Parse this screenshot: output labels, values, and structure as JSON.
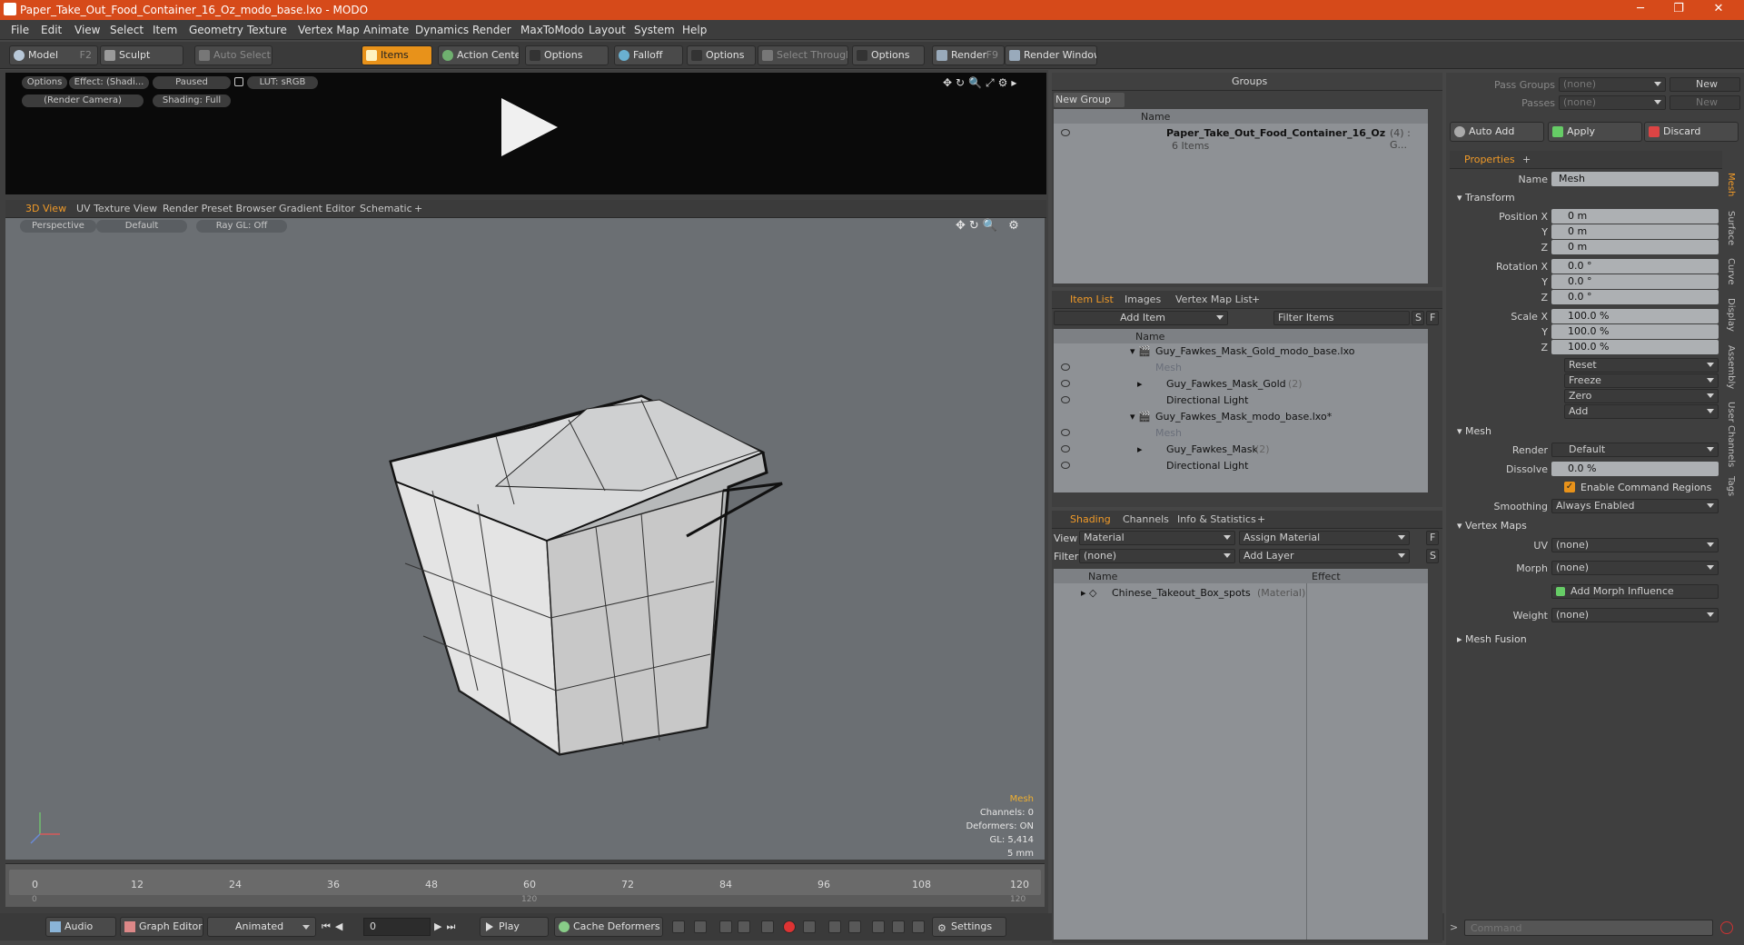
{
  "window": {
    "title": "Paper_Take_Out_Food_Container_16_Oz_modo_base.lxo - MODO"
  },
  "menu": [
    "File",
    "Edit",
    "View",
    "Select",
    "Item",
    "Geometry",
    "Texture",
    "Vertex Map",
    "Animate",
    "Dynamics",
    "Render",
    "MaxToModo",
    "Layout",
    "System",
    "Help"
  ],
  "toolbar": {
    "model": "Model",
    "model_key": "F2",
    "sculpt": "Sculpt",
    "auto_select": "Auto Select",
    "items": "Items",
    "action_center": "Action Center",
    "options1": "Options",
    "falloff": "Falloff",
    "options2": "Options",
    "select_through": "Select Through",
    "options3": "Options",
    "render": "Render",
    "render_key": "F9",
    "render_window": "Render Window"
  },
  "preview": {
    "options": "Options",
    "effect": "Effect: (Shadi...",
    "paused": "Paused",
    "lut": "LUT: sRGB",
    "camera": "(Render Camera)",
    "shading": "Shading: Full"
  },
  "viewport_tabs": [
    "3D View",
    "UV Texture View",
    "Render Preset Browser",
    "Gradient Editor",
    "Schematic",
    "+"
  ],
  "viewport": {
    "perspective": "Perspective",
    "default": "Default",
    "raygl": "Ray GL: Off",
    "info": {
      "mesh": "Mesh",
      "channels": "Channels: 0",
      "deformers": "Deformers: ON",
      "gl": "GL: 5,414",
      "size": "5 mm"
    }
  },
  "timeline": {
    "ticks": [
      "0",
      "12",
      "24",
      "36",
      "48",
      "60",
      "72",
      "84",
      "96",
      "108",
      "120"
    ],
    "sub_left": "0",
    "sub_mid": "120",
    "sub_right": "120"
  },
  "bottom": {
    "audio": "Audio",
    "graph_editor": "Graph Editor",
    "animated": "Animated",
    "frame": "0",
    "play": "Play",
    "cache": "Cache Deformers",
    "settings": "Settings"
  },
  "groups": {
    "title": "Groups",
    "new_group": "New Group",
    "col_name": "Name",
    "item": "Paper_Take_Out_Food_Container_16_Oz",
    "item_count": "(4) : G...",
    "sub": "6 Items"
  },
  "itemlist": {
    "tabs": [
      "Item List",
      "Images",
      "Vertex Map List",
      "+"
    ],
    "add_item": "Add Item",
    "filter": "Filter Items",
    "s": "S",
    "f": "F",
    "col_name": "Name",
    "rows": [
      {
        "label": "Guy_Fawkes_Mask_Gold_modo_base.lxo",
        "extra": ""
      },
      {
        "label": "Mesh",
        "extra": ""
      },
      {
        "label": "Guy_Fawkes_Mask_Gold",
        "extra": "(2)"
      },
      {
        "label": "Directional Light",
        "extra": ""
      },
      {
        "label": "Guy_Fawkes_Mask_modo_base.lxo*",
        "extra": ""
      },
      {
        "label": "Mesh",
        "extra": ""
      },
      {
        "label": "Guy_Fawkes_Mask",
        "extra": "(2)"
      },
      {
        "label": "Directional Light",
        "extra": ""
      }
    ]
  },
  "shading": {
    "tabs": [
      "Shading",
      "Channels",
      "Info & Statistics",
      "+"
    ],
    "view_label": "View",
    "view_val": "Material",
    "assign": "Assign Material",
    "f": "F",
    "filter_label": "Filter",
    "filter_val": "(none)",
    "add_layer": "Add Layer",
    "s": "S",
    "col_name": "Name",
    "col_effect": "Effect",
    "material": "Chinese_Takeout_Box_spots",
    "material_type": "(Material)"
  },
  "passes": {
    "pass_groups": "Pass Groups",
    "pg_val": "(none)",
    "new1": "New",
    "passes": "Passes",
    "p_val": "(none)",
    "new2": "New",
    "auto_add": "Auto Add",
    "apply": "Apply",
    "discard": "Discard"
  },
  "properties": {
    "tab": "Properties",
    "plus": "+",
    "name_label": "Name",
    "name_val": "Mesh",
    "transform": "Transform",
    "pos_label": "Position X",
    "rot_label": "Rotation X",
    "scale_label": "Scale X",
    "y": "Y",
    "z": "Z",
    "pos": [
      "0 m",
      "0 m",
      "0 m"
    ],
    "rot": [
      "0.0 °",
      "0.0 °",
      "0.0 °"
    ],
    "scale": [
      "100.0 %",
      "100.0 %",
      "100.0 %"
    ],
    "reset": "Reset",
    "freeze": "Freeze",
    "zero": "Zero",
    "add": "Add",
    "mesh": "Mesh",
    "render_label": "Render",
    "render_val": "Default",
    "dissolve_label": "Dissolve",
    "dissolve_val": "0.0 %",
    "cmd_regions": "Enable Command Regions",
    "smoothing_label": "Smoothing",
    "smoothing_val": "Always Enabled",
    "vertex_maps": "Vertex Maps",
    "uv_label": "UV",
    "uv_val": "(none)",
    "morph_label": "Morph",
    "morph_val": "(none)",
    "add_morph": "Add Morph Influence",
    "weight_label": "Weight",
    "weight_val": "(none)",
    "mesh_fusion": "Mesh Fusion",
    "side_tabs": [
      "Mesh",
      "Surface",
      "Curve",
      "Display",
      "Assembly",
      "User Channels",
      "Tags"
    ]
  },
  "command": {
    "placeholder": "Command"
  },
  "colors": {
    "accent": "#f09a28",
    "title_bar": "#d64a1a"
  }
}
